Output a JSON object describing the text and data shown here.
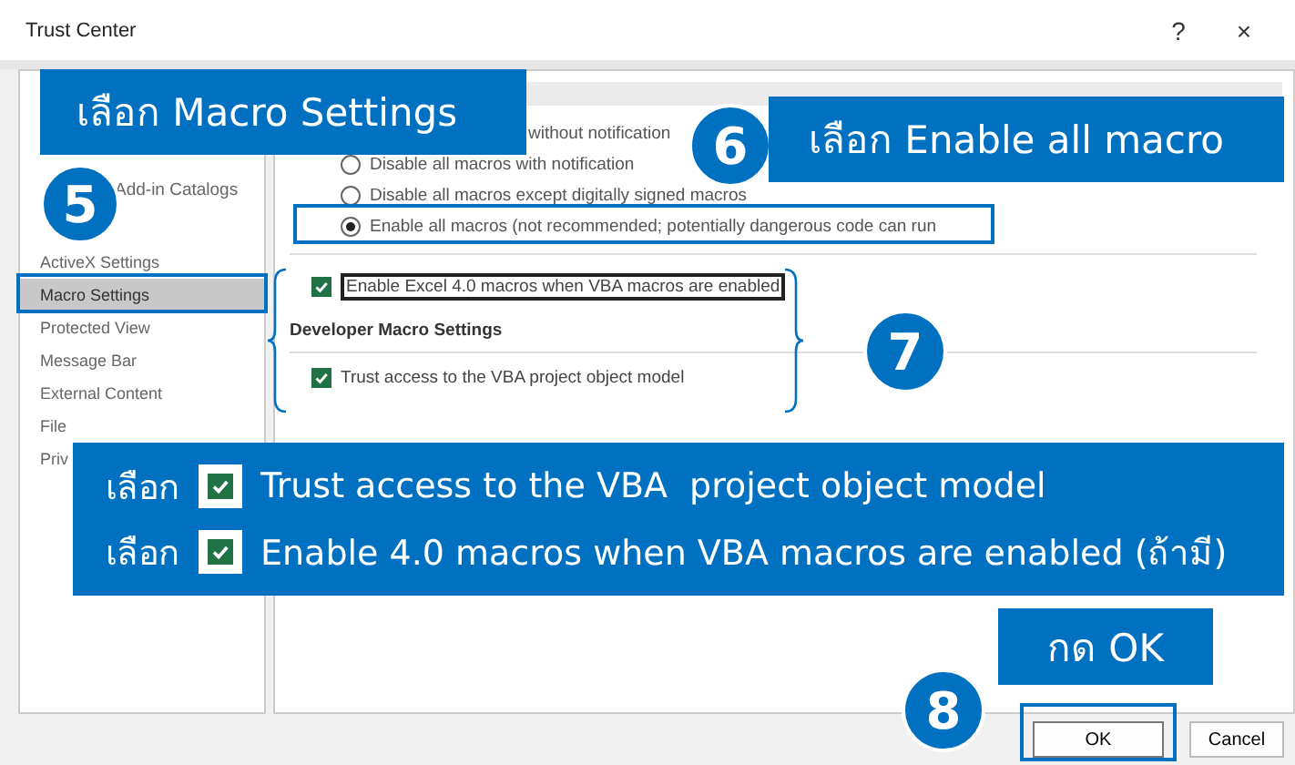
{
  "window": {
    "title": "Trust Center",
    "help": "?",
    "close": "×"
  },
  "sidebar": {
    "partial_item": "Add-in Catalogs",
    "items": [
      {
        "label": "ActiveX Settings",
        "selected": false
      },
      {
        "label": "Macro Settings",
        "selected": true
      },
      {
        "label": "Protected View",
        "selected": false
      },
      {
        "label": "Message Bar",
        "selected": false
      },
      {
        "label": "External Content",
        "selected": false
      },
      {
        "label": "File",
        "selected": false
      },
      {
        "label": "Priv",
        "selected": false
      }
    ]
  },
  "macro_settings": {
    "partial_option": "without notification",
    "options": [
      {
        "label": "Disable all macros with notification",
        "selected": false
      },
      {
        "label": "Disable all macros except digitally signed macros",
        "selected": false
      },
      {
        "label": "Enable all macros (not recommended; potentially dangerous code can run",
        "selected": true
      }
    ],
    "excel4": {
      "label": "Enable Excel 4.0 macros when VBA macros are enabled",
      "checked": true
    },
    "developer_heading": "Developer Macro Settings",
    "trust_vba": {
      "label": "Trust access to the VBA project object model",
      "checked": true
    }
  },
  "buttons": [
    {
      "label": "OK",
      "kind": "primary"
    },
    {
      "label": "Cancel",
      "kind": "secondary"
    }
  ],
  "annotations": {
    "select_macro": {
      "step": "5",
      "text": "เลือก Macro Settings"
    },
    "enable_all": {
      "step": "6",
      "text": "เลือก Enable all macro"
    },
    "checks": {
      "step": "7",
      "lines": [
        {
          "prefix": "เลือก",
          "checked": true,
          "text": "Trust access to the VBA  project object model"
        },
        {
          "prefix": "เลือก",
          "checked": true,
          "text": "Enable 4.0 macros when VBA macros are enabled (ถ้ามี)"
        }
      ]
    },
    "press_ok": {
      "step": "8",
      "text": "กด OK"
    }
  }
}
